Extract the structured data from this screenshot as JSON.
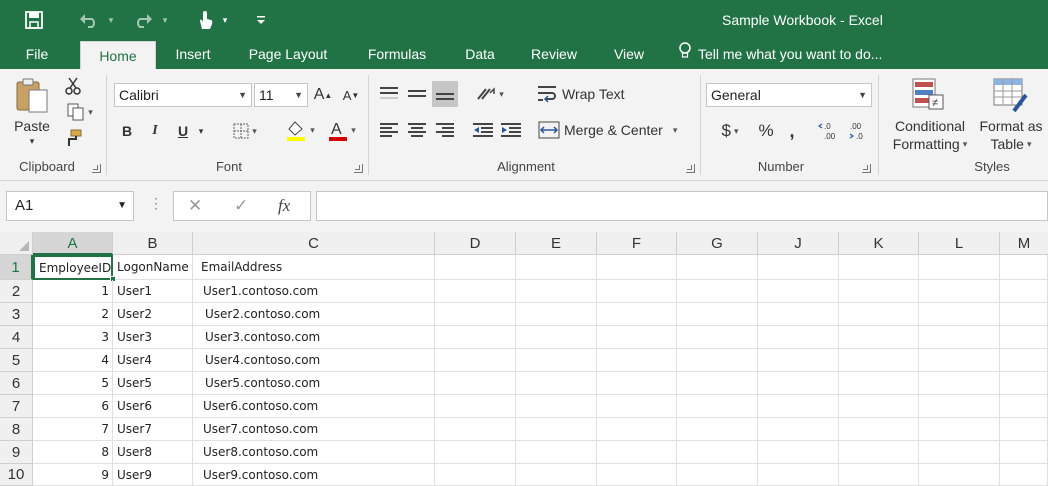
{
  "window": {
    "title": "Sample Workbook  -  Excel"
  },
  "quick_access": {
    "save_icon": "save-icon",
    "undo_icon": "undo-icon",
    "redo_icon": "redo-icon",
    "touch_icon": "touch-mode-icon",
    "customize_icon": "customize-qat-icon"
  },
  "tabs": [
    "File",
    "Home",
    "Insert",
    "Page Layout",
    "Formulas",
    "Data",
    "Review",
    "View"
  ],
  "tell_me": "Tell me what you want to do...",
  "ribbon": {
    "clipboard": {
      "paste": "Paste",
      "label": "Clipboard"
    },
    "font": {
      "name": "Calibri",
      "size": "11",
      "bold": "B",
      "italic": "I",
      "underline": "U",
      "label": "Font"
    },
    "alignment": {
      "wrap_text": "Wrap Text",
      "merge_center": "Merge & Center",
      "label": "Alignment"
    },
    "number": {
      "format": "General",
      "currency": "$",
      "percent": "%",
      "comma": ",",
      "inc_decimal": "←.0 .00",
      "dec_decimal": ".00 →.0",
      "label": "Number"
    },
    "styles": {
      "conditional": "Conditional",
      "conditional2": "Formatting",
      "format_as": "Format as",
      "format_as2": "Table",
      "label": "Styles"
    }
  },
  "formula_bar": {
    "name_box": "A1",
    "cancel": "✕",
    "enter": "✓",
    "fx": "fx",
    "value": ""
  },
  "columns": [
    "A",
    "B",
    "C",
    "D",
    "E",
    "F",
    "G",
    "J",
    "K",
    "L",
    "M"
  ],
  "rows": [
    "1",
    "2",
    "3",
    "4",
    "5",
    "6",
    "7",
    "8",
    "9",
    "10"
  ],
  "sheet": {
    "header": [
      "EmployeeID",
      "LogonName",
      "EmailAddress"
    ],
    "data": [
      [
        "1",
        "User1",
        "User1.contoso.com"
      ],
      [
        "2",
        "User2",
        "User2.contoso.com"
      ],
      [
        "3",
        "User3",
        "User3.contoso.com"
      ],
      [
        "4",
        "User4",
        "User4.contoso.com"
      ],
      [
        "5",
        "User5",
        "User5.contoso.com"
      ],
      [
        "6",
        "User6",
        "User6.contoso.com"
      ],
      [
        "7",
        "User7",
        "User7.contoso.com"
      ],
      [
        "8",
        "User8",
        "User8.contoso.com"
      ],
      [
        "9",
        "User9",
        "User9.contoso.com"
      ]
    ]
  },
  "colors": {
    "accent": "#217346",
    "ribbon_bg": "#f3f3f3",
    "header_bg": "#f0f0f0"
  }
}
